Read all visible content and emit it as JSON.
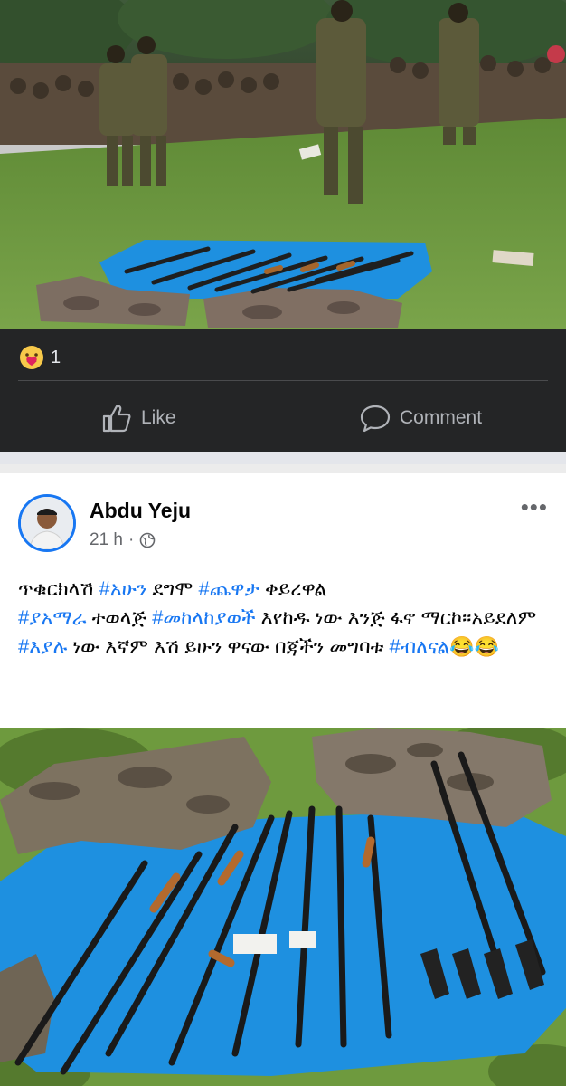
{
  "top_post": {
    "reaction_count": "1",
    "reaction_icon": "care-emoji-icon",
    "like_label": "Like",
    "comment_label": "Comment"
  },
  "post": {
    "author": "Abdu Yeju",
    "time": "21 h",
    "dot": "·",
    "audience_icon": "globe-icon",
    "more_icon": "•••",
    "text_segments": {
      "s1": "ጥቁርክላሽ ",
      "s2": "#አሁን",
      "s3": " ደግሞ ",
      "s4": "#ጨዋታ",
      "s5": " ቀይረዋል",
      "s6": "#ያአማራ",
      "s7": " ተወላጅ ",
      "s8": "#መከላከያወች",
      "s9": " እየከዱ ነው እንጅ ፋኖ ማርኮ።አይደለም ",
      "s10": "#እያሉ",
      "s11": " ነው  እኛም እሽ ይሁን ዋናው በጃችን መግባቱ ",
      "s12": "#ብለናል",
      "s13": "😂😂"
    }
  },
  "colors": {
    "dark_bg": "#242526",
    "link_blue": "#1877f2",
    "tarp_blue": "#1e90e0",
    "grass": "#6e9a3e"
  }
}
